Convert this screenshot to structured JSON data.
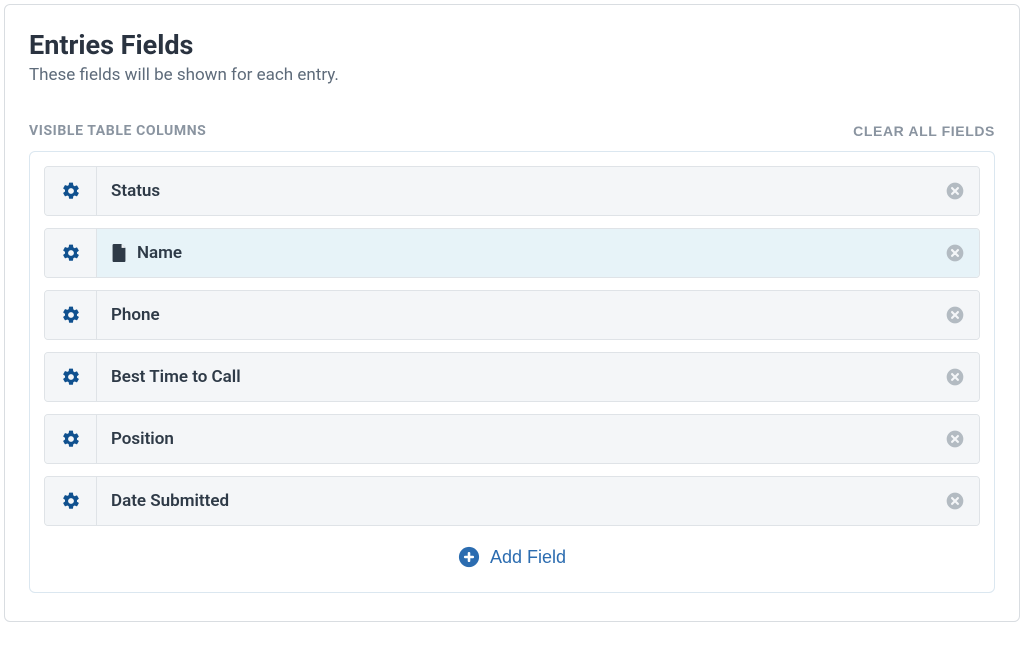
{
  "title": "Entries Fields",
  "subtitle": "These fields will be shown for each entry.",
  "section_label": "VISIBLE TABLE COLUMNS",
  "clear_all_label": "CLEAR ALL FIELDS",
  "add_field_label": "Add Field",
  "fields": [
    {
      "label": "Status",
      "has_icon": false,
      "active": false
    },
    {
      "label": "Name",
      "has_icon": true,
      "active": true
    },
    {
      "label": "Phone",
      "has_icon": false,
      "active": false
    },
    {
      "label": "Best Time to Call",
      "has_icon": false,
      "active": false
    },
    {
      "label": "Position",
      "has_icon": false,
      "active": false
    },
    {
      "label": "Date Submitted",
      "has_icon": false,
      "active": false
    }
  ],
  "colors": {
    "accent": "#10518f",
    "gear": "#10518f",
    "remove": "#b3bbc2",
    "add": "#2b6cb0"
  }
}
